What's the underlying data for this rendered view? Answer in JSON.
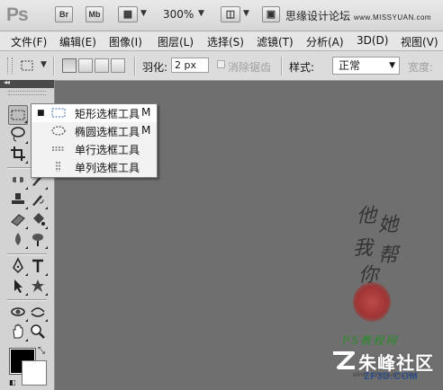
{
  "app": {
    "logo": "Ps",
    "bridge_btn": "Br",
    "minibridge_btn": "Mb",
    "zoom": "300%",
    "watermark": "思缘设计论坛",
    "watermark_url": "www.MISSYUAN.com"
  },
  "menubar": {
    "items": [
      "文件(F)",
      "编辑(E)",
      "图像(I)",
      "图层(L)",
      "选择(S)",
      "滤镜(T)",
      "分析(A)",
      "3D(D)",
      "视图(V)"
    ]
  },
  "options": {
    "feather_label": "羽化:",
    "feather_value": "2 px",
    "antialias_label": "消除锯齿",
    "style_label": "样式:",
    "style_value": "正常",
    "width_label": "宽度:"
  },
  "toolpanel": {
    "collapse_glyph": "◂◂",
    "tools": [
      "rectangular-marquee-icon",
      "lasso-icon",
      "crop-icon",
      "spot-healing-icon",
      "brush-icon",
      "clone-stamp-icon",
      "history-brush-icon",
      "eraser-icon",
      "paint-bucket-icon",
      "blur-icon",
      "dodge-icon",
      "pen-icon",
      "type-icon",
      "path-selection-icon",
      "custom-shape-icon",
      "3d-rotate-icon",
      "3d-orbit-icon",
      "hand-icon",
      "zoom-icon"
    ]
  },
  "flyout": {
    "items": [
      {
        "label": "矩形选框工具",
        "key": "M",
        "icon": "rect-marquee-icon",
        "selected": true
      },
      {
        "label": "椭圆选框工具",
        "key": "M",
        "icon": "ellipse-marquee-icon",
        "selected": false
      },
      {
        "label": "单行选框工具",
        "key": "",
        "icon": "single-row-marquee-icon",
        "selected": false
      },
      {
        "label": "单列选框工具",
        "key": "",
        "icon": "single-column-marquee-icon",
        "selected": false
      }
    ]
  },
  "canvas": {
    "calligraphy": [
      "他",
      "她",
      "我",
      "帮",
      "你"
    ],
    "seal_icon": "seal-stamp-icon",
    "tutorial_text": "PS教程网",
    "site_url": "www.missyuan.com",
    "brand_name": "朱峰社区",
    "brand_url": "ZF3D.COM"
  },
  "colors": {
    "canvas_bg": "#6f6f6f",
    "panel_bg": "#d3d3d3",
    "foreground": "#000000",
    "background": "#ffffff"
  }
}
